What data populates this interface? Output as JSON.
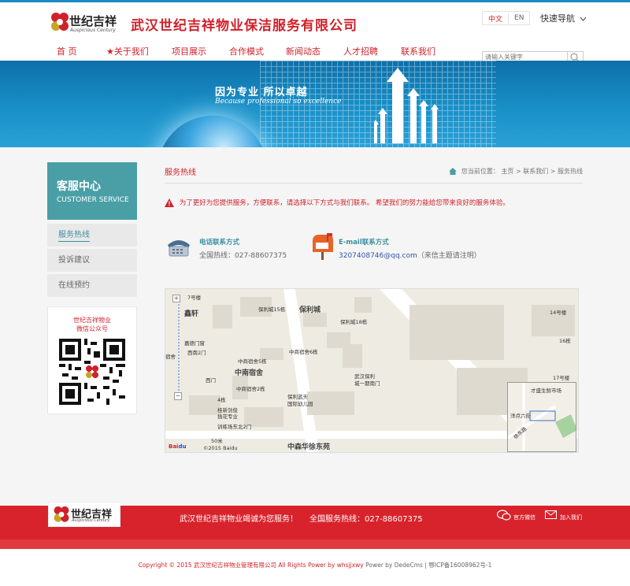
{
  "header": {
    "logo_cn": "世纪吉祥",
    "logo_en": "Auspicious Century",
    "company_name": "武汉世纪吉祥物业保洁服务有限公司",
    "lang_cn": "中文",
    "lang_en": "EN",
    "quick_nav": "快速导航"
  },
  "nav": {
    "items": [
      {
        "label": "首 页"
      },
      {
        "label": "★关于我们"
      },
      {
        "label": "项目展示"
      },
      {
        "label": "合作模式"
      },
      {
        "label": "新闻动态"
      },
      {
        "label": "人才招聘"
      },
      {
        "label": "联系我们"
      }
    ]
  },
  "search": {
    "placeholder": "请输入关键字"
  },
  "banner": {
    "slogan": "因为专业  所以卓越",
    "slogan_en": "Because professional so excellence"
  },
  "sidebar": {
    "title": "客服中心",
    "subtitle": "CUSTOMER SERVICE",
    "items": [
      {
        "label": "服务热线"
      },
      {
        "label": "投诉建议"
      },
      {
        "label": "在线预约"
      }
    ],
    "qr_line1": "世纪吉祥物业",
    "qr_line2": "微信公众号"
  },
  "main": {
    "section_title": "服务热线",
    "breadcrumb": "您当前位置： 主页 > 联系我们 > 服务热线",
    "notice": "为了更好为您提供服务，方便联系，请选择以下方式与我们联系。 希望我们的努力能给您带来良好的服务体验。",
    "phone_title": "电话联系方式",
    "phone_value": "全国热线：027-88607375",
    "email_title": "E-mail联系方式",
    "email_value": "3207408746@qq.com",
    "email_note": "（来信主题请注明）"
  },
  "map": {
    "labels": {
      "l1": "保利城15栋",
      "l2": "保利城",
      "l3": "保利城18栋",
      "l4": "14号楼",
      "l5": "16栋",
      "l6": "中商宿舍6栋",
      "l7": "中商宿舍5栋",
      "l8": "中南宿舍",
      "l9": "中商宿舍2栋",
      "l10": "武汉保利",
      "l11": "城一期南门",
      "l12": "保利蓝天",
      "l13": "国际幼儿园",
      "l14": "17号楼",
      "l15": "中森华徐东苑",
      "l16": "西门",
      "l17": "4栋",
      "l18": "桂新剑俊",
      "l19": "插花专业",
      "l20": "训练场东北2门",
      "l21": "嘉德门窗",
      "l22": "西南2门",
      "l23": "宿舍",
      "l24": "鑫轩",
      "l25": "7号楼",
      "l26": "才盛生鲜市场",
      "l27": "洋点六街",
      "l28": "徐东路",
      "scale": "50米",
      "baidu": "©2015 Baidu"
    }
  },
  "footer": {
    "slogan": "武汉世纪吉祥物业竭诚为您服务！",
    "hotline": "全国服务热线：027-88607375",
    "wechat": "官方微信",
    "join": "加入我们",
    "copyright_red": "Copyright © 2015 武汉世纪吉祥物业管理有限公司 All Rights Power by whsjjxwy",
    "copyright_gray": "Power by DedeCms | 鄂ICP备16008962号-1"
  }
}
